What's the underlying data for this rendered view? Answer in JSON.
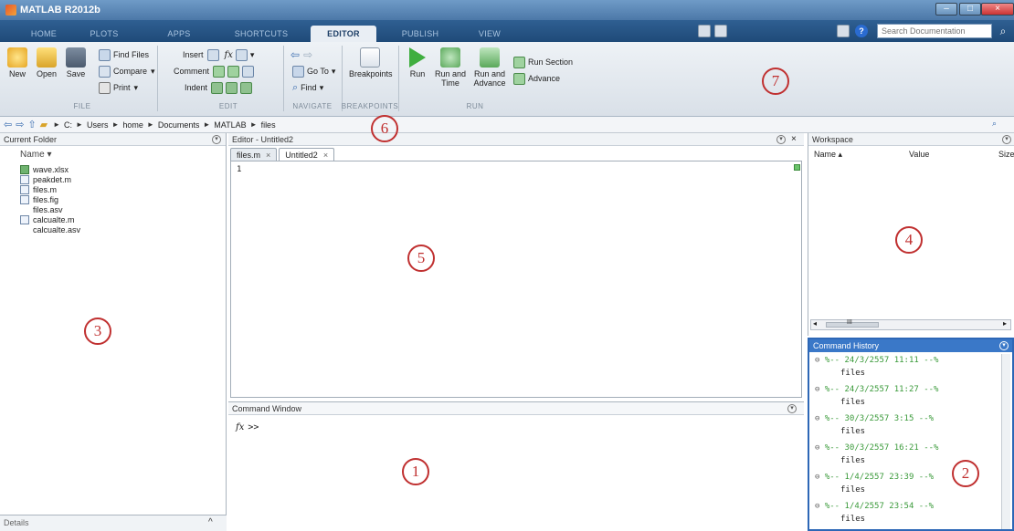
{
  "window": {
    "title": "MATLAB R2012b"
  },
  "tabs": [
    {
      "label": "HOME"
    },
    {
      "label": "PLOTS"
    },
    {
      "label": "APPS"
    },
    {
      "label": "SHORTCUTS"
    },
    {
      "label": "EDITOR"
    },
    {
      "label": "PUBLISH"
    },
    {
      "label": "VIEW"
    }
  ],
  "search": {
    "placeholder": "Search Documentation"
  },
  "ribbon": {
    "file": {
      "new": "New",
      "open": "Open",
      "save": "Save",
      "find_files": "Find Files",
      "compare": "Compare",
      "print": "Print",
      "group": "FILE"
    },
    "edit": {
      "insert": "Insert",
      "comment": "Comment",
      "indent": "Indent",
      "group": "EDIT"
    },
    "navigate": {
      "go_to": "Go To",
      "find": "Find",
      "group": "NAVIGATE"
    },
    "breakpoints": {
      "label": "Breakpoints",
      "group": "BREAKPOINTS"
    },
    "run": {
      "run": "Run",
      "run_and_time": "Run and Time",
      "run_and_advance": "Run and Advance",
      "run_section": "Run Section",
      "advance": "Advance",
      "group": "RUN"
    }
  },
  "address": {
    "crumbs": [
      "C:",
      "Users",
      "home",
      "Documents",
      "MATLAB",
      "files"
    ]
  },
  "current_folder": {
    "title": "Current Folder",
    "column": "Name",
    "files": [
      {
        "name": "wave.xlsx",
        "type": "xl"
      },
      {
        "name": "peakdet.m",
        "type": "m"
      },
      {
        "name": "files.m",
        "type": "m"
      },
      {
        "name": "files.fig",
        "type": "fig"
      },
      {
        "name": "files.asv",
        "type": "blank"
      },
      {
        "name": "calcualte.m",
        "type": "m"
      },
      {
        "name": "calcualte.asv",
        "type": "blank"
      }
    ],
    "details": "Details"
  },
  "editor": {
    "title": "Editor - Untitled2",
    "tabs": [
      {
        "label": "files.m"
      },
      {
        "label": "Untitled2"
      }
    ],
    "line": "1"
  },
  "command_window": {
    "title": "Command Window",
    "prompt": ">>",
    "fx": "fx"
  },
  "workspace": {
    "title": "Workspace",
    "cols": [
      "Name",
      "Value",
      "Size"
    ],
    "scroll_mark": "III"
  },
  "history": {
    "title": "Command History",
    "entries": [
      {
        "ts": "%-- 24/3/2557 11:11 --%",
        "cmd": "files"
      },
      {
        "ts": "%-- 24/3/2557 11:27 --%",
        "cmd": "files"
      },
      {
        "ts": "%-- 30/3/2557 3:15 --%",
        "cmd": "files"
      },
      {
        "ts": "%-- 30/3/2557 16:21 --%",
        "cmd": "files"
      },
      {
        "ts": "%-- 1/4/2557 23:39 --%",
        "cmd": "files"
      },
      {
        "ts": "%-- 1/4/2557 23:54 --%",
        "cmd": "files"
      }
    ]
  },
  "callouts": [
    "1",
    "2",
    "3",
    "4",
    "5",
    "6",
    "7"
  ],
  "colors": {
    "callout": "#c03030",
    "tabstrip": "#1f4a78",
    "history_head": "#3a78c8"
  }
}
